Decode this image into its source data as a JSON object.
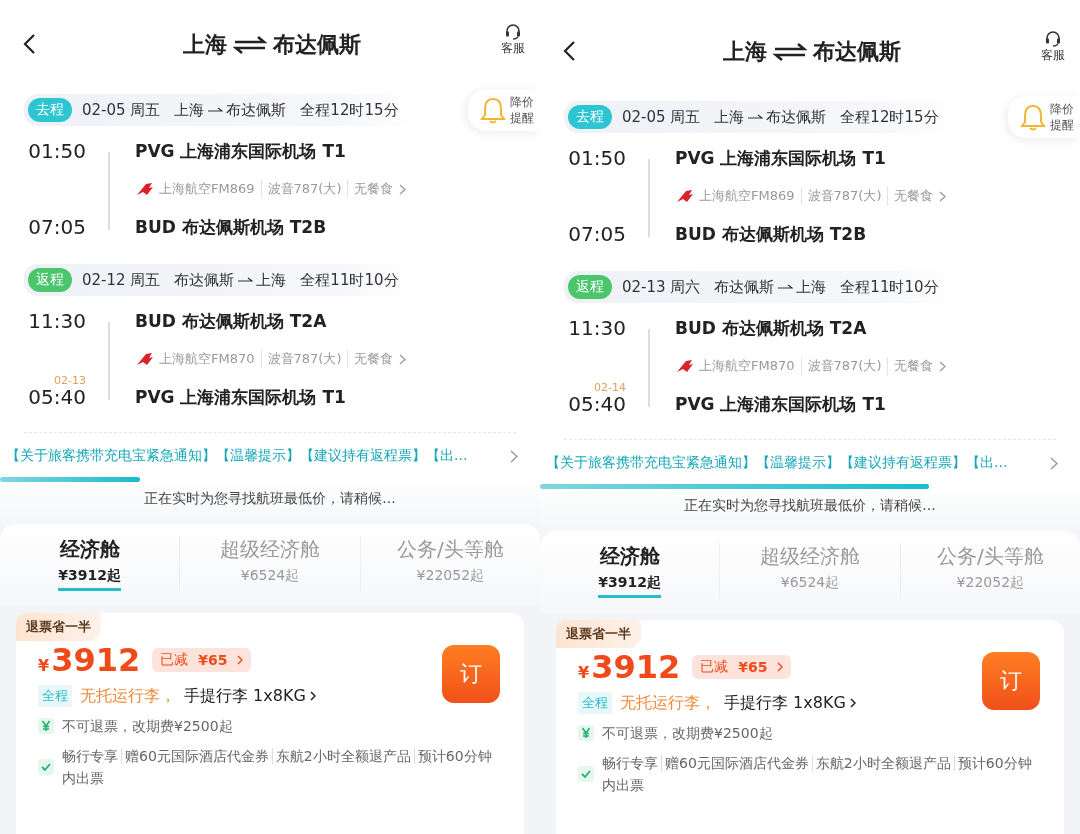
{
  "panels": [
    {
      "title_from": "上海",
      "title_to": "布达佩斯",
      "service_label": "客服",
      "price_alert_label": "降价提醒",
      "legs": [
        {
          "tag": "去程",
          "color": "#2ec5d3",
          "date": "02-05 周五",
          "route_from": "上海",
          "route_to": "布达佩斯",
          "duration": "全程12时15分",
          "depart_time": "01:50",
          "depart_airport": "PVG 上海浦东国际机场 T1",
          "airline": "上海航空FM869",
          "aircraft": "波音787(大)",
          "meal": "无餐食",
          "arrive_time": "07:05",
          "arrive_airport": "BUD 布达佩斯机场 T2B"
        },
        {
          "tag": "返程",
          "color": "#4cc66c",
          "date": "02-12 周五",
          "route_from": "布达佩斯",
          "route_to": "上海",
          "duration": "全程11时10分",
          "depart_time": "11:30",
          "depart_airport": "BUD 布达佩斯机场 T2A",
          "airline": "上海航空FM870",
          "aircraft": "波音787(大)",
          "meal": "无餐食",
          "arrive_date": "02-13",
          "arrive_time": "05:40",
          "arrive_airport": "PVG 上海浦东国际机场 T1"
        }
      ],
      "notice": "【关于旅客携带充电宝紧急通知】【温馨提示】【建议持有返程票】【出...",
      "progress": {
        "level": 0.26
      },
      "loading_text": "正在实时为您寻找航班最低价，请稍候...",
      "cabins": [
        {
          "name": "经济舱",
          "price": "¥3912起",
          "selected": true
        },
        {
          "name": "超级经济舱",
          "price": "¥6524起",
          "selected": false
        },
        {
          "name": "公务/头等舱",
          "price": "¥22052起",
          "selected": false
        }
      ],
      "fare": {
        "badge": "退票省一半",
        "currency": "¥",
        "price": "3912",
        "discount_label": "已减",
        "discount": "¥65",
        "scope_tag": "全程",
        "baggage": "无托运行李，",
        "carry_on": "手提行李 1x8KG",
        "book": "订",
        "rules": [
          {
            "kind": "refund",
            "segments": [
              "不可退票，改期费¥2500起"
            ]
          },
          {
            "kind": "perk",
            "segments": [
              "畅行专享",
              "赠60元国际酒店代金券",
              "东航2小时全额退产品",
              "预计60分钟内出票"
            ]
          }
        ]
      }
    },
    {
      "title_from": "上海",
      "title_to": "布达佩斯",
      "service_label": "客服",
      "price_alert_label": "降价提醒",
      "legs": [
        {
          "tag": "去程",
          "color": "#2ec5d3",
          "date": "02-05 周五",
          "route_from": "上海",
          "route_to": "布达佩斯",
          "duration": "全程12时15分",
          "depart_time": "01:50",
          "depart_airport": "PVG 上海浦东国际机场 T1",
          "airline": "上海航空FM869",
          "aircraft": "波音787(大)",
          "meal": "无餐食",
          "arrive_time": "07:05",
          "arrive_airport": "BUD 布达佩斯机场 T2B"
        },
        {
          "tag": "返程",
          "color": "#4cc66c",
          "date": "02-13 周六",
          "route_from": "布达佩斯",
          "route_to": "上海",
          "duration": "全程11时10分",
          "depart_time": "11:30",
          "depart_airport": "BUD 布达佩斯机场 T2A",
          "airline": "上海航空FM870",
          "aircraft": "波音787(大)",
          "meal": "无餐食",
          "arrive_date": "02-14",
          "arrive_time": "05:40",
          "arrive_airport": "PVG 上海浦东国际机场 T1"
        }
      ],
      "notice": "【关于旅客携带充电宝紧急通知】【温馨提示】【建议持有返程票】【出...",
      "progress": {
        "level": 0.72
      },
      "loading_text": "正在实时为您寻找航班最低价，请稍候...",
      "cabins": [
        {
          "name": "经济舱",
          "price": "¥3912起",
          "selected": true
        },
        {
          "name": "超级经济舱",
          "price": "¥6524起",
          "selected": false
        },
        {
          "name": "公务/头等舱",
          "price": "¥22052起",
          "selected": false
        }
      ],
      "fare": {
        "badge": "退票省一半",
        "currency": "¥",
        "price": "3912",
        "discount_label": "已减",
        "discount": "¥65",
        "scope_tag": "全程",
        "baggage": "无托运行李，",
        "carry_on": "手提行李 1x8KG",
        "book": "订",
        "rules": [
          {
            "kind": "refund",
            "segments": [
              "不可退票，改期费¥2500起"
            ]
          },
          {
            "kind": "perk",
            "segments": [
              "畅行专享",
              "赠60元国际酒店代金券",
              "东航2小时全额退产品",
              "预计60分钟内出票"
            ]
          }
        ]
      }
    }
  ]
}
